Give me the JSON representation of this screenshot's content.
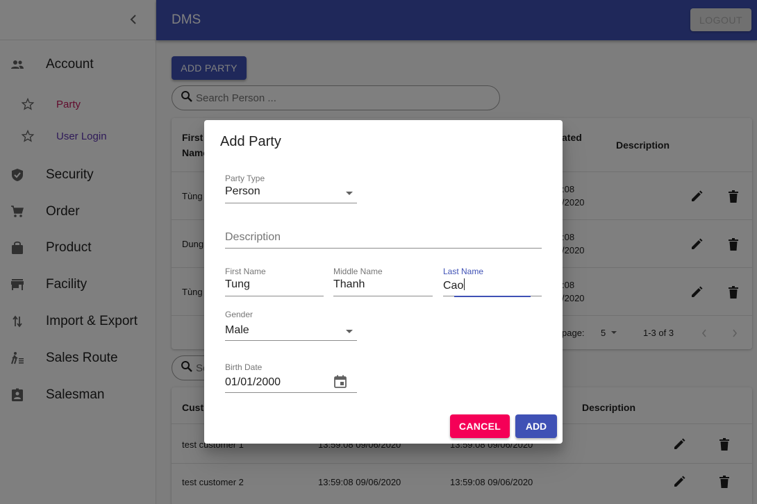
{
  "app": {
    "title": "DMS",
    "logout_label": "LOGOUT"
  },
  "sidebar": {
    "items": [
      {
        "label": "Account",
        "icon": "people-icon"
      },
      {
        "label": "Party",
        "icon": "star-outline-icon",
        "sub": true,
        "color": "#c2185b"
      },
      {
        "label": "User Login",
        "icon": "star-outline-icon",
        "sub": true,
        "color": "#5e35b1"
      },
      {
        "label": "Security",
        "icon": "shield-icon"
      },
      {
        "label": "Order",
        "icon": "cart-icon"
      },
      {
        "label": "Product",
        "icon": "shopping-bag-icon"
      },
      {
        "label": "Facility",
        "icon": "store-icon"
      },
      {
        "label": "Import & Export",
        "icon": "swap-vert-icon"
      },
      {
        "label": "Sales Route",
        "icon": "walking-icon"
      },
      {
        "label": "Salesman",
        "icon": "badge-icon"
      }
    ]
  },
  "main": {
    "add_party_label": "ADD PARTY",
    "search_person_placeholder": "Search Person ...",
    "party_table": {
      "headers": [
        "First Name",
        "Created",
        "Description"
      ],
      "header_first_line1": "First",
      "header_first_line2": "Name",
      "header_created_fragment": "ated",
      "rows": [
        {
          "first": "Tùng",
          "created_time": ":08",
          "created_date": "/2020"
        },
        {
          "first": "Dung",
          "created_time": ":08",
          "created_date": "/2020"
        },
        {
          "first": "Tùng",
          "created_time": ":08",
          "created_date": "/2020"
        }
      ],
      "rows_per_page_label": "page:",
      "rows_per_page_value": "5",
      "range_label": "1-3 of 3"
    },
    "customer_table": {
      "search_fragment": "Se",
      "header_first_fragment": "Cust",
      "header_description": "Description",
      "rows": [
        {
          "name": "test customer 1",
          "created": "13:59:08 09/06/2020",
          "updated": "13:59:08 09/06/2020"
        },
        {
          "name": "test customer 2",
          "created": "13:59:08 09/06/2020",
          "updated": "13:59:08 09/06/2020"
        }
      ]
    }
  },
  "dialog": {
    "title": "Add Party",
    "party_type": {
      "label": "Party Type",
      "value": "Person"
    },
    "description": {
      "placeholder": "Description"
    },
    "first_name": {
      "label": "First Name",
      "value": "Tung"
    },
    "middle_name": {
      "label": "Middle Name",
      "value": "Thanh"
    },
    "last_name": {
      "label": "Last Name",
      "value": "Cao"
    },
    "gender": {
      "label": "Gender",
      "value": "Male"
    },
    "birth_date": {
      "label": "Birth Date",
      "value": "01/01/2000"
    },
    "cancel_label": "CANCEL",
    "add_label": "ADD"
  },
  "colors": {
    "primary": "#3f51b5",
    "secondary": "#f50057"
  }
}
